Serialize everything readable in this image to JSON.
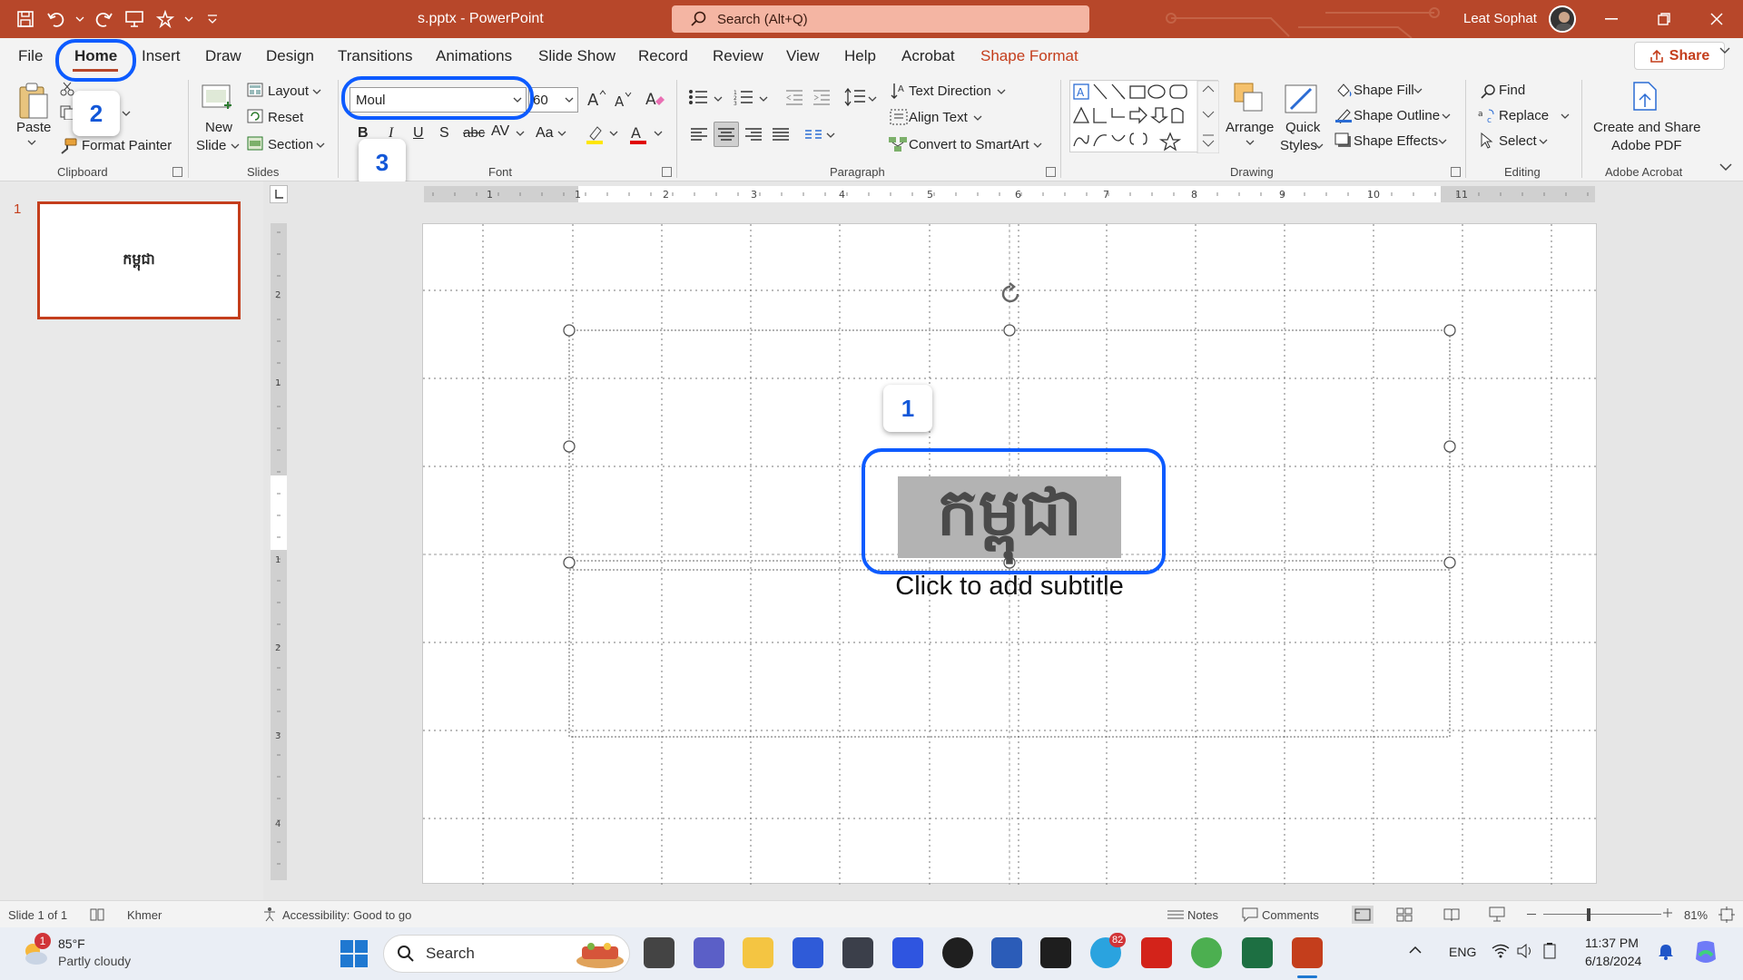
{
  "titlebar": {
    "doc_title": "s.pptx  -  PowerPoint",
    "search_placeholder": "Search (Alt+Q)",
    "user_name": "Leat Sophat"
  },
  "tabs": [
    "File",
    "Home",
    "Insert",
    "Draw",
    "Design",
    "Transitions",
    "Animations",
    "Slide Show",
    "Record",
    "Review",
    "View",
    "Help",
    "Acrobat",
    "Shape Format"
  ],
  "share_label": "Share",
  "ribbon": {
    "clipboard": {
      "paste": "Paste",
      "cut": "Cut",
      "format_painter": "Format Painter",
      "label": "Clipboard"
    },
    "slides": {
      "new_slide_1": "New",
      "new_slide_2": "Slide",
      "layout": "Layout",
      "reset": "Reset",
      "section": "Section",
      "label": "Slides"
    },
    "font": {
      "font_name": "Moul",
      "font_size": "60",
      "label": "Font"
    },
    "paragraph": {
      "text_direction": "Text Direction",
      "align_text": "Align Text",
      "convert_smartart": "Convert to SmartArt",
      "label": "Paragraph"
    },
    "drawing": {
      "arrange": "Arrange",
      "quick_styles_1": "Quick",
      "quick_styles_2": "Styles",
      "shape_fill": "Shape Fill",
      "shape_outline": "Shape Outline",
      "shape_effects": "Shape Effects",
      "label": "Drawing"
    },
    "editing": {
      "find": "Find",
      "replace": "Replace",
      "select": "Select",
      "label": "Editing"
    },
    "acrobat": {
      "create_1": "Create and Share",
      "create_2": "Adobe PDF",
      "label": "Adobe Acrobat"
    }
  },
  "callouts": {
    "one": "1",
    "two": "2",
    "three": "3"
  },
  "thumbnail": {
    "number": "1",
    "text": "កម្ពុជា"
  },
  "slide": {
    "title_text": "កម្ពុជា",
    "subtitle_placeholder": "Click to add subtitle"
  },
  "ruler": {
    "h_labels": [
      "1",
      "1",
      "2",
      "3",
      "4",
      "5",
      "6",
      "7",
      "8",
      "9",
      "10",
      "11"
    ],
    "v_labels": [
      "2",
      "1",
      "1",
      "2",
      "3",
      "4"
    ]
  },
  "status": {
    "slide_count": "Slide 1 of 1",
    "language": "Khmer",
    "accessibility": "Accessibility: Good to go",
    "notes": "Notes",
    "comments": "Comments",
    "zoom": "81%"
  },
  "taskbar": {
    "weather_temp": "85°F",
    "weather_desc": "Partly cloudy",
    "weather_badge": "1",
    "search": "Search",
    "telegram_badge": "82",
    "lang": "ENG",
    "time": "11:37 PM",
    "date": "6/18/2024"
  },
  "colors": {
    "accent": "#b7472a",
    "callout": "#0d5bff",
    "shape_format": "#c43e1c"
  }
}
